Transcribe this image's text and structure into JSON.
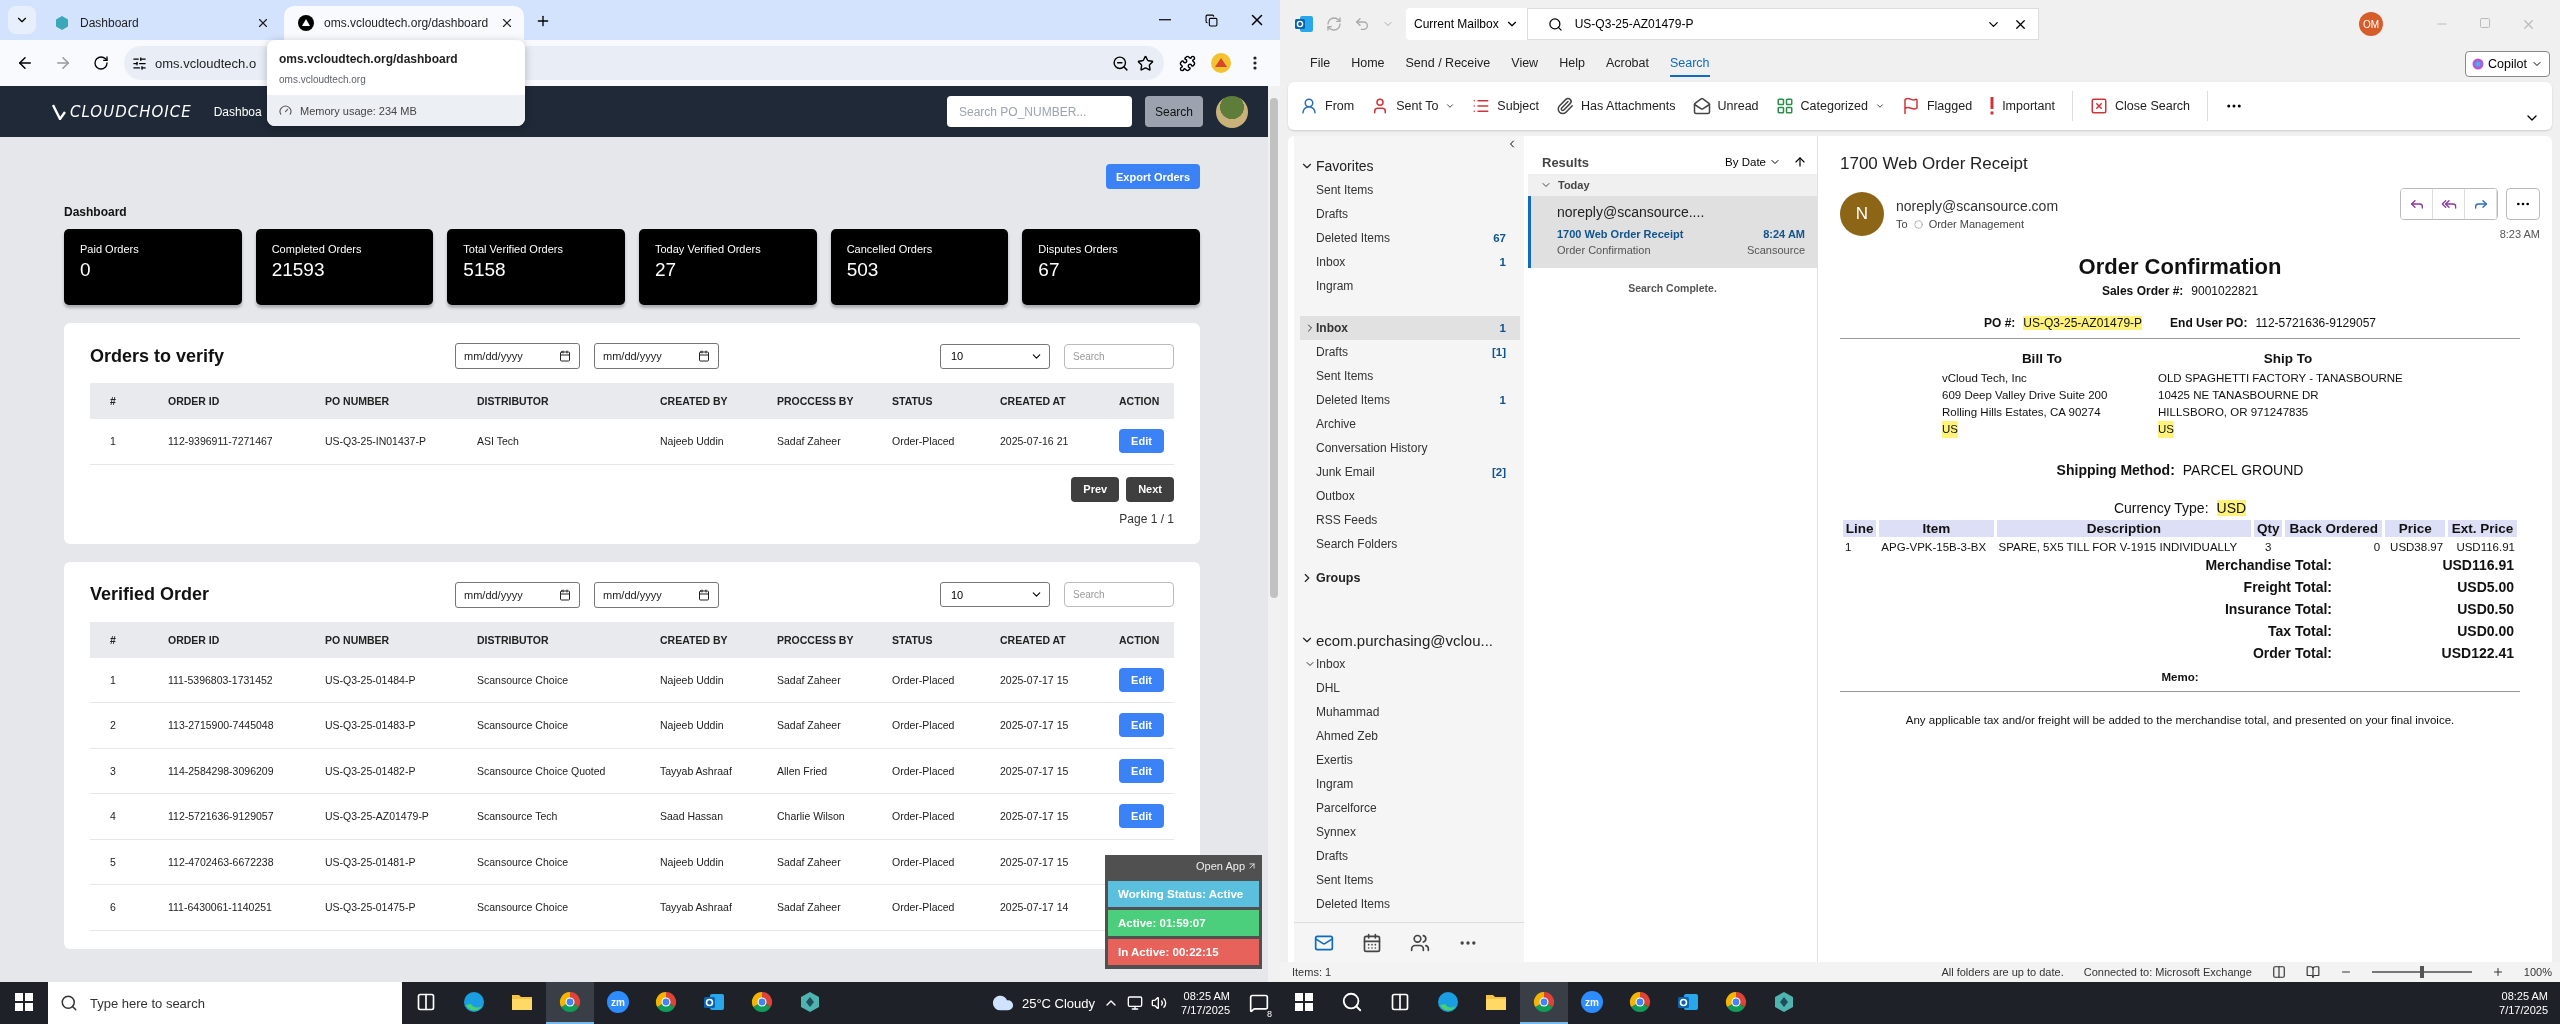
{
  "browser": {
    "tabs": [
      {
        "title": "Dashboard",
        "kind": "app",
        "selected": false
      },
      {
        "title": "oms.vcloudtech.org/dashboard",
        "kind": "site",
        "selected": true
      }
    ],
    "address": "oms.vcloudtech.o",
    "hover_card": {
      "title": "oms.vcloudtech.org/dashboard",
      "host": "oms.vcloudtech.org",
      "memory": "Memory usage: 234 MB"
    }
  },
  "app": {
    "logo": "CLOUDCHOICE",
    "nav": [
      "Dashboa"
    ],
    "search": {
      "placeholder": "Search PO_NUMBER..."
    },
    "search_button": "Search",
    "export_button": "Export Orders",
    "heading": "Dashboard",
    "stats": [
      {
        "label": "Paid Orders",
        "value": "0"
      },
      {
        "label": "Completed Orders",
        "value": "21593"
      },
      {
        "label": "Total Verified Orders",
        "value": "5158"
      },
      {
        "label": "Today Verified Orders",
        "value": "27"
      },
      {
        "label": "Cancelled Orders",
        "value": "503"
      },
      {
        "label": "Disputes Orders",
        "value": "67"
      }
    ],
    "orders_to_verify": {
      "title": "Orders to verify",
      "date_from": {
        "placeholder": "mm/dd/yyyy"
      },
      "date_to": {
        "placeholder": "mm/dd/yyyy"
      },
      "page_size": "10",
      "search": {
        "placeholder": "Search"
      },
      "columns": [
        "#",
        "ORDER ID",
        "PO NUMBER",
        "DISTRIBUTOR",
        "CREATED BY",
        "PROCCESS BY",
        "STATUS",
        "CREATED AT",
        "ACTION"
      ],
      "rows": [
        {
          "cells": [
            "1",
            "112-9396911-7271467",
            "US-Q3-25-IN01437-P",
            "ASI Tech",
            "Najeeb Uddin",
            "Sadaf Zaheer",
            "Order-Placed",
            "2025-07-16 21"
          ],
          "action": "Edit"
        }
      ],
      "prev": "Prev",
      "next": "Next",
      "page": "Page 1 / 1"
    },
    "verified_orders": {
      "title": "Verified Order",
      "date_from": {
        "placeholder": "mm/dd/yyyy"
      },
      "date_to": {
        "placeholder": "mm/dd/yyyy"
      },
      "page_size": "10",
      "search": {
        "placeholder": "Search"
      },
      "columns": [
        "#",
        "ORDER ID",
        "PO NUMBER",
        "DISTRIBUTOR",
        "CREATED BY",
        "PROCCESS BY",
        "STATUS",
        "CREATED AT",
        "ACTION"
      ],
      "rows": [
        {
          "cells": [
            "1",
            "111-5396803-1731452",
            "US-Q3-25-01484-P",
            "Scansource Choice",
            "Najeeb Uddin",
            "Sadaf Zaheer",
            "Order-Placed",
            "2025-07-17 15"
          ],
          "action": "Edit"
        },
        {
          "cells": [
            "2",
            "113-2715900-7445048",
            "US-Q3-25-01483-P",
            "Scansource Choice",
            "Najeeb Uddin",
            "Sadaf Zaheer",
            "Order-Placed",
            "2025-07-17 15"
          ],
          "action": "Edit"
        },
        {
          "cells": [
            "3",
            "114-2584298-3096209",
            "US-Q3-25-01482-P",
            "Scansource Choice Quoted",
            "Tayyab Ashraaf",
            "Allen Fried",
            "Order-Placed",
            "2025-07-17 15"
          ],
          "action": "Edit"
        },
        {
          "cells": [
            "4",
            "112-5721636-9129057",
            "US-Q3-25-AZ01479-P",
            "Scansource Tech",
            "Saad Hassan",
            "Charlie Wilson",
            "Order-Placed",
            "2025-07-17 15"
          ],
          "action": "Edit"
        },
        {
          "cells": [
            "5",
            "112-4702463-6672238",
            "US-Q3-25-01481-P",
            "Scansource Choice",
            "Najeeb Uddin",
            "Sadaf Zaheer",
            "Order-Placed",
            "2025-07-17 15"
          ]
        },
        {
          "cells": [
            "6",
            "111-6430061-1140251",
            "US-Q3-25-01475-P",
            "Scansource Choice",
            "Tayyab Ashraaf",
            "Sadaf Zaheer",
            "Order-Placed",
            "2025-07-17 14"
          ]
        }
      ]
    }
  },
  "widget": {
    "open": "Open App",
    "statuses": [
      {
        "label": "Working Status: Active",
        "color": "#5bc0de"
      },
      {
        "label": "Active: 01:59:07",
        "color": "#4ccf7c"
      },
      {
        "label": "In Active: 00:22:15",
        "color": "#e8625c"
      }
    ]
  },
  "left_taskbar": {
    "search": {
      "placeholder": "Type here to search"
    },
    "apps": [
      {
        "kind": "taskview",
        "selected": false
      },
      {
        "kind": "edge",
        "selected": false
      },
      {
        "kind": "files",
        "selected": false
      },
      {
        "kind": "browser",
        "selected": true
      },
      {
        "kind": "meeting",
        "glyph": "zm",
        "selected": false
      },
      {
        "kind": "browser",
        "selected": false
      },
      {
        "kind": "mail",
        "selected": false
      },
      {
        "kind": "browser",
        "selected": false
      },
      {
        "kind": "hex",
        "selected": false
      }
    ],
    "weather": "25°C Cloudy",
    "time": "08:25 AM",
    "date": "7/17/2025",
    "notifications": "8"
  },
  "outlook": {
    "scope": "Current Mailbox",
    "search_value": "US-Q3-25-AZ01479-P",
    "user_initials": "OM",
    "menu": [
      {
        "label": "File",
        "selected": false
      },
      {
        "label": "Home",
        "selected": false
      },
      {
        "label": "Send / Receive",
        "selected": false
      },
      {
        "label": "View",
        "selected": false
      },
      {
        "label": "Help",
        "selected": false
      },
      {
        "label": "Acrobat",
        "selected": false
      },
      {
        "label": "Search",
        "selected": true
      }
    ],
    "copilot": "Copilot",
    "ribbon": [
      {
        "kind": "from",
        "label": "From"
      },
      {
        "kind": "sent-to",
        "label": "Sent To",
        "dropdown": true
      },
      {
        "kind": "subject",
        "label": "Subject"
      },
      {
        "kind": "attachments",
        "label": "Has Attachments"
      },
      {
        "kind": "unread",
        "label": "Unread"
      },
      {
        "kind": "categorized",
        "label": "Categorized",
        "dropdown": true
      },
      {
        "kind": "flagged",
        "label": "Flagged"
      },
      {
        "kind": "important",
        "label": "Important"
      },
      {
        "kind": "close",
        "label": "Close Search"
      }
    ],
    "folder_pane": {
      "favorites": {
        "label": "Favorites",
        "expanded": true,
        "items": [
          {
            "label": "Sent Items",
            "selected": false
          },
          {
            "label": "Drafts",
            "selected": false
          },
          {
            "label": "Deleted Items",
            "count": "67",
            "selected": false
          },
          {
            "label": "Inbox",
            "count": "1",
            "selected": false
          },
          {
            "label": "Ingram",
            "selected": false
          }
        ]
      },
      "mailbox_folders": [
        {
          "label": "Inbox",
          "count": "1",
          "expanded": false,
          "selected": true
        },
        {
          "label": "Drafts",
          "count": "[1]",
          "selected": false
        },
        {
          "label": "Sent Items",
          "selected": false
        },
        {
          "label": "Deleted Items",
          "count": "1",
          "selected": false
        },
        {
          "label": "Archive",
          "selected": false
        },
        {
          "label": "Conversation History",
          "selected": false
        },
        {
          "label": "Junk Email",
          "count": "[2]",
          "selected": false
        },
        {
          "label": "Outbox",
          "selected": false
        },
        {
          "label": "RSS Feeds",
          "selected": false
        },
        {
          "label": "Search Folders",
          "selected": false
        }
      ],
      "groups": {
        "label": "Groups",
        "expanded": false
      },
      "account": {
        "label": "ecom.purchasing@vclou...",
        "expanded": true,
        "folders": [
          {
            "label": "Inbox",
            "expanded": true,
            "selected": false,
            "children": [
              {
                "label": "DHL",
                "selected": false
              },
              {
                "label": "Muhammad",
                "selected": false
              },
              {
                "label": "Ahmed Zeb",
                "selected": false
              },
              {
                "label": "Exertis",
                "selected": false
              },
              {
                "label": "Ingram",
                "selected": false
              },
              {
                "label": "Parcelforce",
                "selected": false
              },
              {
                "label": "Synnex",
                "selected": false
              }
            ]
          },
          {
            "label": "Drafts",
            "selected": false
          },
          {
            "label": "Sent Items",
            "selected": false
          },
          {
            "label": "Deleted Items",
            "selected": false
          }
        ]
      }
    },
    "results": {
      "title": "Results",
      "sort": "By Date",
      "group": {
        "label": "Today",
        "expanded": true
      },
      "messages": [
        {
          "sender": "noreply@scansource....",
          "subject": "1700 Web Order Receipt",
          "time": "8:24 AM",
          "preview": "Order Confirmation",
          "folder": "Scansource",
          "selected": true
        }
      ],
      "status": "Search Complete."
    },
    "email": {
      "subject": "1700 Web Order Receipt",
      "avatar": "N",
      "from": "noreply@scansource.com",
      "to_label": "To",
      "to": "Order Management",
      "time": "8:23 AM",
      "body": {
        "title": "Order Confirmation",
        "sales_order": {
          "label": "Sales Order #:",
          "value": "9001022821"
        },
        "po": {
          "label": "PO #:",
          "value": "US-Q3-25-AZ01479-P",
          "highlighted": true
        },
        "end_user_po": {
          "label": "End User PO:",
          "value": "112-5721636-9129057"
        },
        "bill_to": {
          "title": "Bill To",
          "lines": [
            {
              "text": "vCloud Tech, Inc",
              "highlighted": false
            },
            {
              "text": "609 Deep Valley Drive Suite 200",
              "highlighted": false
            },
            {
              "text": "Rolling Hills Estates, CA 90274",
              "highlighted": false
            },
            {
              "text": "US",
              "highlighted": true
            }
          ]
        },
        "ship_to": {
          "title": "Ship To",
          "lines": [
            {
              "text": "OLD SPAGHETTI FACTORY - TANASBOURNE",
              "highlighted": false
            },
            {
              "text": "10425 NE TANASBOURNE DR",
              "highlighted": false
            },
            {
              "text": "HILLSBORO, OR 971247835",
              "highlighted": false
            },
            {
              "text": "US",
              "highlighted": true
            }
          ]
        },
        "shipping": {
          "label": "Shipping Method:",
          "value": "PARCEL GROUND"
        },
        "currency": {
          "label": "Currency Type:",
          "value": "USD",
          "highlighted": true
        },
        "line_table": {
          "columns": [
            "Line",
            "Item",
            "Description",
            "Qty",
            "Back Ordered",
            "Price",
            "Ext. Price"
          ],
          "rows": [
            [
              "1",
              "APG-VPK-15B-3-BX",
              "SPARE, 5X5 TILL FOR V-1915 INDIVIDUALLY",
              "3",
              "0",
              "USD38.97",
              "USD116.91"
            ]
          ]
        },
        "totals": [
          {
            "label": "Merchandise Total:",
            "value": "USD116.91"
          },
          {
            "label": "Freight Total:",
            "value": "USD5.00"
          },
          {
            "label": "Insurance Total:",
            "value": "USD0.50"
          },
          {
            "label": "Tax Total:",
            "value": "USD0.00"
          },
          {
            "label": "Order Total:",
            "value": "USD122.41"
          }
        ],
        "memo": "Memo:",
        "note": "Any applicable tax and/or freight will be added to the merchandise total, and presented on your final invoice."
      }
    },
    "status_bar": {
      "items": "Items: 1",
      "sync": "All folders are up to date.",
      "connection": "Connected to: Microsoft Exchange",
      "zoom": "100%",
      "zoom_slider": {
        "level": 0.5
      }
    }
  },
  "right_taskbar": {
    "apps": [
      {
        "kind": "search",
        "selected": false
      },
      {
        "kind": "taskview",
        "selected": false
      },
      {
        "kind": "edge",
        "selected": false
      },
      {
        "kind": "files",
        "selected": false
      },
      {
        "kind": "browser",
        "selected": true
      },
      {
        "kind": "meeting",
        "glyph": "zm",
        "selected": false
      },
      {
        "kind": "browser",
        "selected": false
      },
      {
        "kind": "mail",
        "selected": false
      },
      {
        "kind": "browser",
        "selected": false
      },
      {
        "kind": "hex",
        "selected": false
      }
    ],
    "time": "08:25 AM",
    "date": "7/17/2025"
  }
}
